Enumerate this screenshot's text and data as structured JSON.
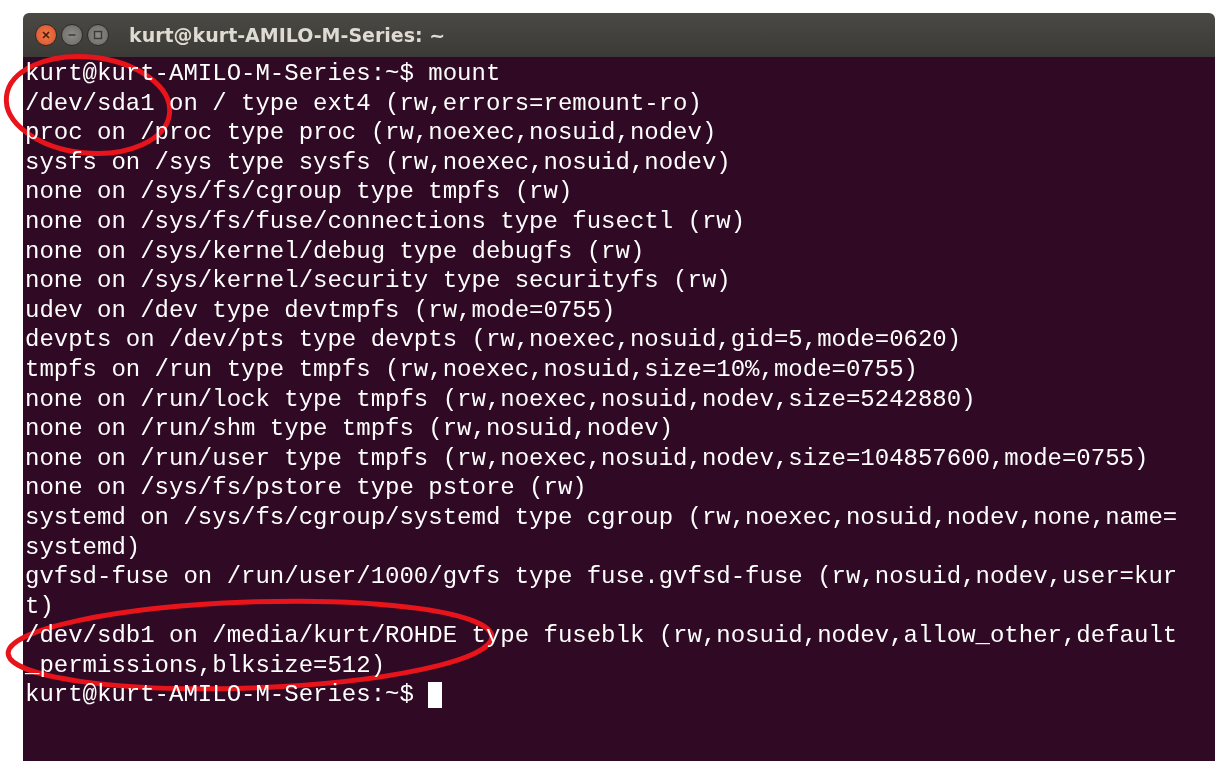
{
  "window": {
    "title": "kurt@kurt-AMILO-M-Series: ~",
    "buttons": [
      {
        "kind": "close"
      },
      {
        "kind": "minimize"
      },
      {
        "kind": "maximize"
      }
    ]
  },
  "terminal": {
    "lines": [
      "kurt@kurt-AMILO-M-Series:~$ mount",
      "/dev/sda1 on / type ext4 (rw,errors=remount-ro)",
      "proc on /proc type proc (rw,noexec,nosuid,nodev)",
      "sysfs on /sys type sysfs (rw,noexec,nosuid,nodev)",
      "none on /sys/fs/cgroup type tmpfs (rw)",
      "none on /sys/fs/fuse/connections type fusectl (rw)",
      "none on /sys/kernel/debug type debugfs (rw)",
      "none on /sys/kernel/security type securityfs (rw)",
      "udev on /dev type devtmpfs (rw,mode=0755)",
      "devpts on /dev/pts type devpts (rw,noexec,nosuid,gid=5,mode=0620)",
      "tmpfs on /run type tmpfs (rw,noexec,nosuid,size=10%,mode=0755)",
      "none on /run/lock type tmpfs (rw,noexec,nosuid,nodev,size=5242880)",
      "none on /run/shm type tmpfs (rw,nosuid,nodev)",
      "none on /run/user type tmpfs (rw,noexec,nosuid,nodev,size=104857600,mode=0755)",
      "none on /sys/fs/pstore type pstore (rw)",
      "systemd on /sys/fs/cgroup/systemd type cgroup (rw,noexec,nosuid,nodev,none,name=",
      "systemd)",
      "gvfsd-fuse on /run/user/1000/gvfs type fuse.gvfsd-fuse (rw,nosuid,nodev,user=kur",
      "t)",
      "/dev/sdb1 on /media/kurt/ROHDE type fuseblk (rw,nosuid,nodev,allow_other,default",
      "_permissions,blksize=512)"
    ],
    "prompt": "kurt@kurt-AMILO-M-Series:~$"
  }
}
